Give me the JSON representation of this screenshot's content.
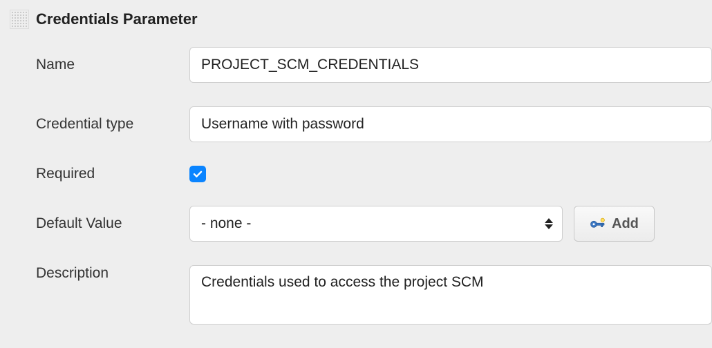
{
  "section": {
    "title": "Credentials Parameter"
  },
  "labels": {
    "name": "Name",
    "credential_type": "Credential type",
    "required": "Required",
    "default_value": "Default Value",
    "description": "Description"
  },
  "fields": {
    "name": "PROJECT_SCM_CREDENTIALS",
    "credential_type": "Username with password",
    "required": true,
    "default_value": "- none -",
    "description": "Credentials used to access the project SCM"
  },
  "buttons": {
    "add": "Add"
  }
}
